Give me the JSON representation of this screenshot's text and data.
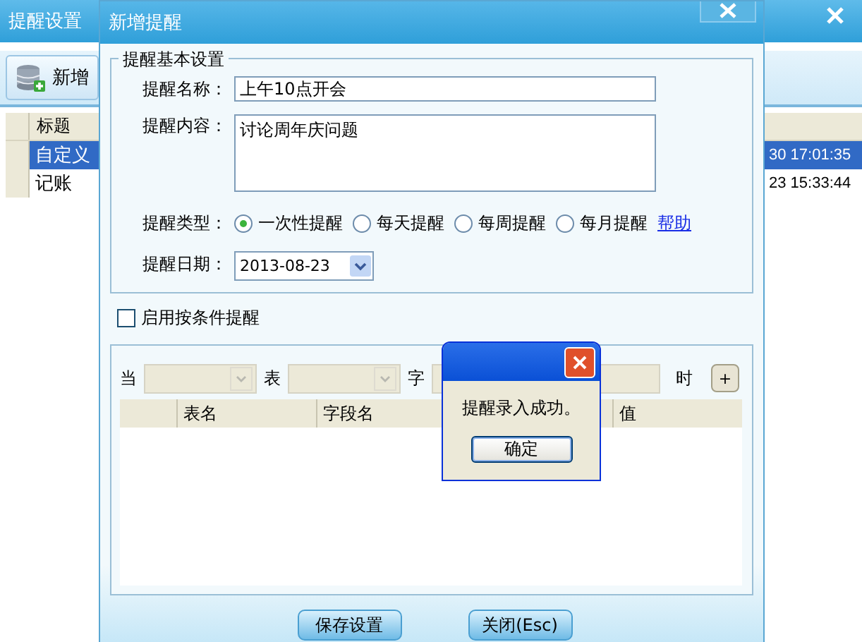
{
  "main_window": {
    "title": "提醒设置",
    "toolbar": [
      {
        "label": "新增"
      }
    ],
    "table": {
      "columns": [
        {
          "label": "标题"
        }
      ],
      "rows": [
        {
          "title": "自定义",
          "time": "30 17:01:35",
          "selected": true
        },
        {
          "title": "记账",
          "time": "23 15:33:44",
          "selected": false
        }
      ]
    }
  },
  "dialog": {
    "title": "新增提醒",
    "basic_group": {
      "legend": "提醒基本设置",
      "name_label": "提醒名称：",
      "name_value": "上午10点开会",
      "content_label": "提醒内容：",
      "content_value": "讨论周年庆问题",
      "type_label": "提醒类型：",
      "types": [
        {
          "label": "一次性提醒",
          "selected": true
        },
        {
          "label": "每天提醒",
          "selected": false
        },
        {
          "label": "每周提醒",
          "selected": false
        },
        {
          "label": "每月提醒",
          "selected": false
        }
      ],
      "help_link": "帮助",
      "date_label": "提醒日期：",
      "date_value": "2013-08-23"
    },
    "condition_toggle": {
      "label": "启用按条件提醒",
      "checked": false
    },
    "condition": {
      "when_label": "当",
      "table_label": "表",
      "field_label": "字",
      "time_label": "时",
      "add_button": "+",
      "columns": [
        {
          "label": "表名"
        },
        {
          "label": "字段名"
        },
        {
          "label": "值"
        }
      ]
    },
    "buttons": [
      {
        "label": "保存设置"
      },
      {
        "label": "关闭(Esc)"
      }
    ]
  },
  "message_box": {
    "text": "提醒录入成功。",
    "button": "确定"
  }
}
